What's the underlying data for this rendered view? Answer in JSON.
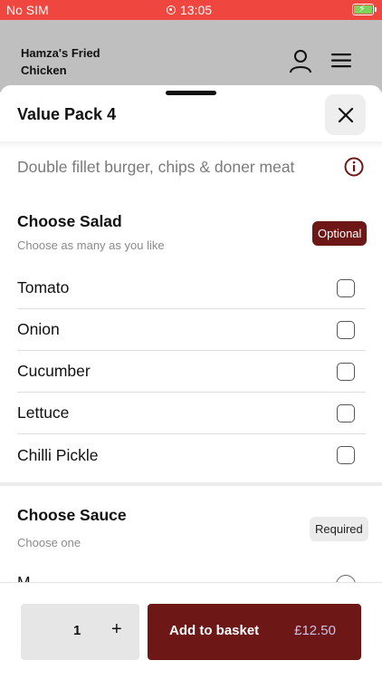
{
  "status_bar": {
    "carrier": "No SIM",
    "time": "13:05"
  },
  "header": {
    "restaurant_name": "Hamza's Fried Chicken",
    "account_icon": "user-icon",
    "menu_icon": "hamburger-menu-icon"
  },
  "sheet": {
    "title": "Value Pack 4",
    "description": "Double fillet burger, chips & doner meat",
    "close_icon": "close-icon",
    "info_icon": "info-icon"
  },
  "salad_section": {
    "title": "Choose Salad",
    "subtitle": "Choose as many as you like",
    "badge": "Optional",
    "options": [
      {
        "label": "Tomato",
        "checked": false
      },
      {
        "label": "Onion",
        "checked": false
      },
      {
        "label": "Cucumber",
        "checked": false
      },
      {
        "label": "Lettuce",
        "checked": false
      },
      {
        "label": "Chilli Pickle",
        "checked": false
      }
    ]
  },
  "sauce_section": {
    "title": "Choose Sauce",
    "subtitle": "Choose one",
    "badge": "Required",
    "first_option_partial": "M"
  },
  "bottom_bar": {
    "quantity": "1",
    "increment_symbol": "+",
    "add_label": "Add to basket",
    "price": "£12.50"
  },
  "colors": {
    "status_bar": "#f04640",
    "accent": "#6e1717",
    "price_text": "#c8c3e9"
  }
}
